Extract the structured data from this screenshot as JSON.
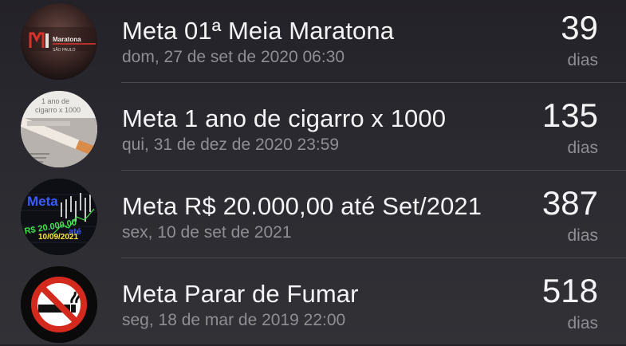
{
  "goals": [
    {
      "title": "Meta 01ª Meia Maratona",
      "date": "dom, 27 de set de 2020 06:30",
      "count": "39",
      "unit": "dias",
      "avatar": {
        "icon": "half-marathon-logo-icon",
        "brand": "Maratona",
        "city": "SÃO PAULO"
      }
    },
    {
      "title": "Meta 1 ano de cigarro x 1000",
      "date": "qui, 31 de dez de 2020 23:59",
      "count": "135",
      "unit": "dias",
      "avatar": {
        "icon": "cigarette-poster-icon",
        "line1": "1 ano de",
        "line2": "cigarro x 1000"
      }
    },
    {
      "title": "Meta R$ 20.000,00 até Set/2021",
      "date": "sex, 10 de set de 2021",
      "count": "387",
      "unit": "dias",
      "avatar": {
        "icon": "stock-chart-goal-icon",
        "word1": "Meta",
        "amount": "R$ 20.000,00",
        "word2": "até",
        "date": "10/09/2021"
      }
    },
    {
      "title": "Meta Parar de Fumar",
      "date": "seg, 18 de mar de 2019 22:00",
      "count": "518",
      "unit": "dias",
      "avatar": {
        "icon": "no-smoking-icon"
      }
    }
  ],
  "colors": {
    "background": "#2a2a30",
    "primary_text": "#f4f4f6",
    "secondary_text": "#8e8e94",
    "divider": "#4a4a50",
    "no_smoking_red": "#d42a1e",
    "chart_text_green": "#3fe04a",
    "chart_text_blue": "#3a5cff"
  }
}
